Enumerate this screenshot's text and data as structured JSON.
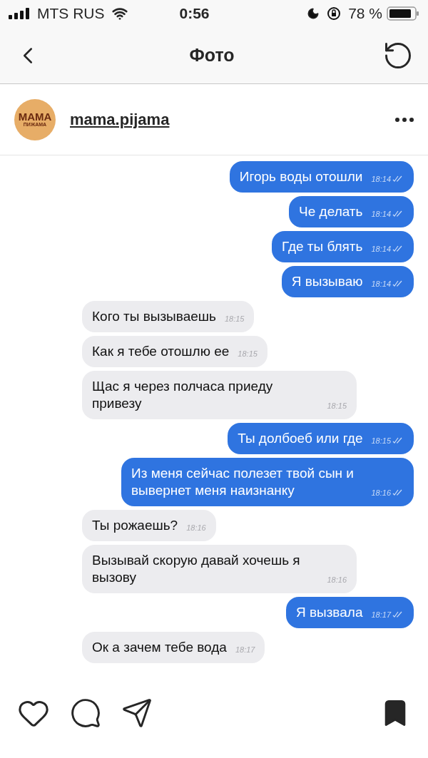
{
  "status_bar": {
    "carrier": "MTS RUS",
    "time": "0:56",
    "battery": "78 %"
  },
  "nav": {
    "title": "Фото"
  },
  "post": {
    "username": "mama.pijama",
    "avatar_text": [
      "МАМА",
      "ПИЖАМА"
    ],
    "messages": [
      {
        "kind": "sent",
        "text": "Игорь воды отошли",
        "time": "18:14"
      },
      {
        "kind": "sent",
        "text": "Че делать",
        "time": "18:14"
      },
      {
        "kind": "sent",
        "text": "Где ты блять",
        "time": "18:14"
      },
      {
        "kind": "sent",
        "text": "Я вызываю",
        "time": "18:14"
      },
      {
        "kind": "received",
        "text": "Кого ты вызываешь",
        "time": "18:15"
      },
      {
        "kind": "received",
        "text": "Как я тебе отошлю ее",
        "time": "18:15"
      },
      {
        "kind": "received",
        "text": "Щас я через полчаса приеду привезу",
        "time": "18:15"
      },
      {
        "kind": "sent",
        "text": "Ты долбоеб или где",
        "time": "18:15"
      },
      {
        "kind": "sent",
        "text": "Из меня сейчас полезет твой сын и вывернет меня наизнанку",
        "time": "18:16"
      },
      {
        "kind": "received",
        "text": "Ты рожаешь?",
        "time": "18:16"
      },
      {
        "kind": "received",
        "text": "Вызывай скорую давай хочешь я вызову",
        "time": "18:16"
      },
      {
        "kind": "sent",
        "text": "Я вызвала",
        "time": "18:17"
      },
      {
        "kind": "received",
        "text": "Ок а зачем тебе вода",
        "time": "18:17"
      }
    ],
    "liked": false,
    "saved": true
  }
}
